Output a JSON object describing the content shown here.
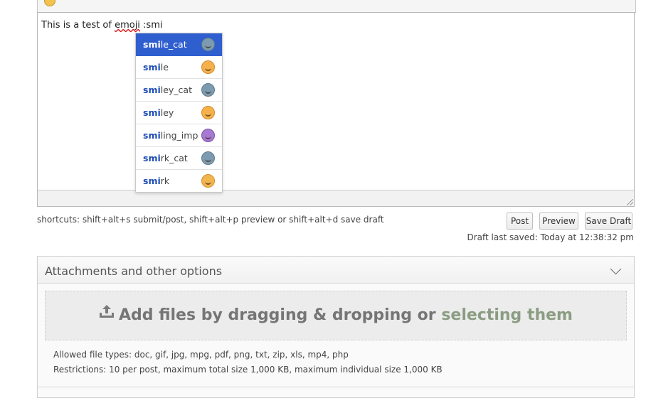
{
  "editor": {
    "text_before": "This is a test of ",
    "text_misspelled": "emoji",
    "text_after": " :smi"
  },
  "autocomplete": {
    "items": [
      {
        "match": "smi",
        "rest": "le_cat",
        "emoji": "smile-cat-icon",
        "selected": true
      },
      {
        "match": "smi",
        "rest": "le",
        "emoji": "smile-icon",
        "selected": false
      },
      {
        "match": "smi",
        "rest": "ley_cat",
        "emoji": "smiley-cat-icon",
        "selected": false
      },
      {
        "match": "smi",
        "rest": "ley",
        "emoji": "smiley-icon",
        "selected": false
      },
      {
        "match": "smi",
        "rest": "ling_imp",
        "emoji": "smiling-imp-icon",
        "selected": false
      },
      {
        "match": "smi",
        "rest": "rk_cat",
        "emoji": "smirk-cat-icon",
        "selected": false
      },
      {
        "match": "smi",
        "rest": "rk",
        "emoji": "smirk-icon",
        "selected": false
      }
    ],
    "selected_color": "#2f5fcf"
  },
  "shortcuts_text": "shortcuts: shift+alt+s submit/post, shift+alt+p preview or shift+alt+d save draft",
  "buttons": {
    "post": "Post",
    "preview": "Preview",
    "save_draft": "Save Draft"
  },
  "draft_status": "Draft last saved: Today at 12:38:32 pm",
  "attachments": {
    "title": "Attachments and other options",
    "dropzone_text": "Add files by dragging & dropping or ",
    "dropzone_link": "selecting them",
    "allowed_types": "Allowed file types: doc, gif, jpg, mpg, pdf, png, txt, zip, xls, mp4, php",
    "restrictions": "Restrictions: 10 per post, maximum total size 1,000 KB, maximum individual size 1,000 KB"
  }
}
